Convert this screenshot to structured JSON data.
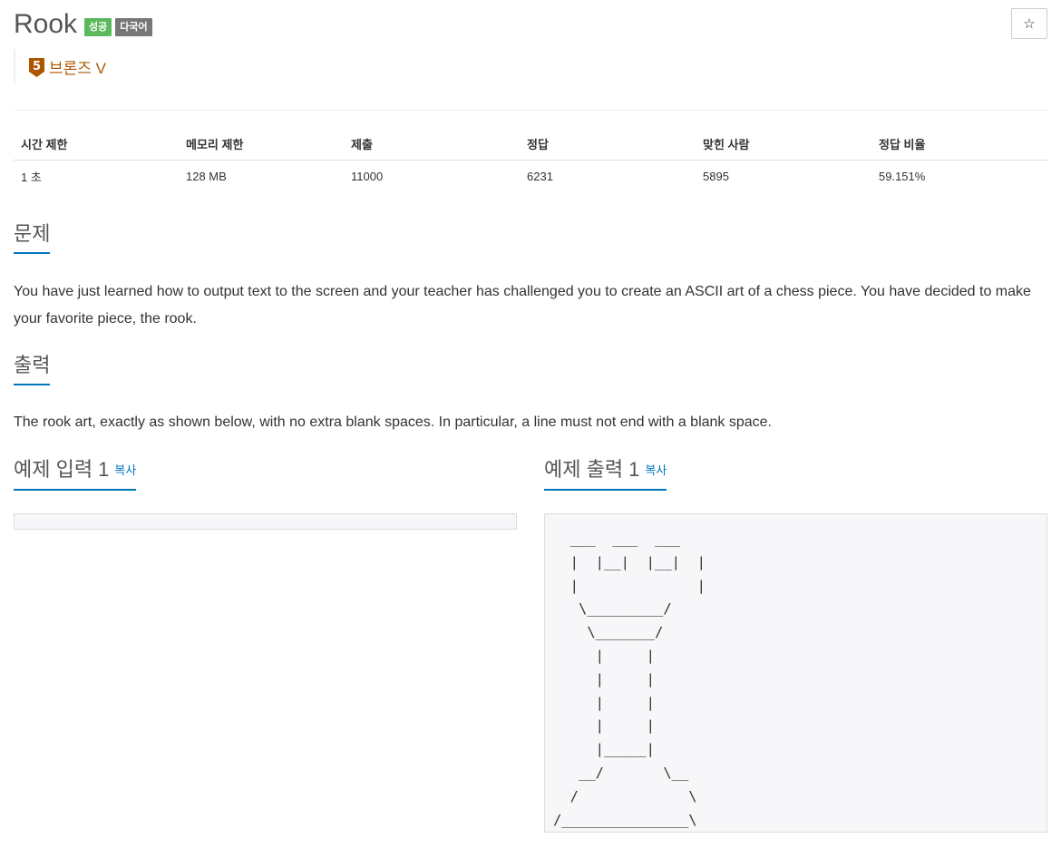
{
  "problem": {
    "title": "Rook",
    "badges": [
      "성공",
      "다국어"
    ],
    "star_icon": "☆",
    "tier": {
      "level": "5",
      "name": "브론즈 V",
      "color": "#ad5600"
    }
  },
  "stats": {
    "headers": [
      "시간 제한",
      "메모리 제한",
      "제출",
      "정답",
      "맞힌 사람",
      "정답 비율"
    ],
    "values": [
      "1 초",
      "128 MB",
      "11000",
      "6231",
      "5895",
      "59.151%"
    ]
  },
  "sections": {
    "description": {
      "heading": "문제",
      "text": "You have just learned how to output text to the screen and your teacher has challenged you to create an ASCII art of a chess piece. You have decided to make your favorite piece, the rook."
    },
    "output": {
      "heading": "출력",
      "text": "The rook art, exactly as shown below, with no extra blank spaces. In particular, a line must not end with a blank space."
    },
    "sample_input": {
      "heading": "예제 입력 1",
      "copy_label": "복사",
      "content": ""
    },
    "sample_output": {
      "heading": "예제 출력 1",
      "copy_label": "복사",
      "content": "  ___  ___  ___\n  |  |__|  |__|  |\n  |              |\n   \\_________/\n    \\_______/\n     |     |\n     |     |\n     |     |\n     |     |\n     |_____|\n   __/       \\__\n  /             \\\n/_______________\\"
    }
  },
  "colors": {
    "accent": "#0076c0",
    "success": "#5cb85c",
    "bronze": "#ad5600"
  }
}
